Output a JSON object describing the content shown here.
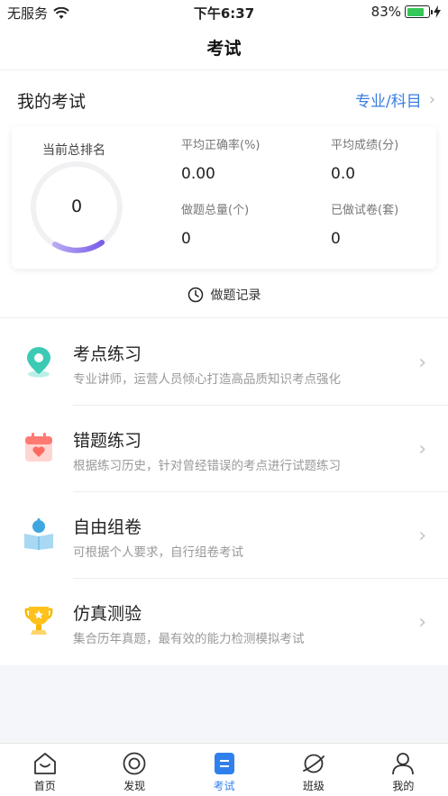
{
  "status_bar": {
    "carrier": "无服务",
    "time": "下午6:37",
    "battery": "83%",
    "battery_level": 0.83
  },
  "nav": {
    "title": "考试"
  },
  "my_exam": {
    "title": "我的考试",
    "subject_link": "专业/科目"
  },
  "stats": {
    "rank_label": "当前总排名",
    "rank_value": "0",
    "accuracy_label": "平均正确率(%)",
    "accuracy_value": "0.00",
    "score_label": "平均成绩(分)",
    "score_value": "0.0",
    "questions_label": "做题总量(个)",
    "questions_value": "0",
    "papers_label": "已做试卷(套)",
    "papers_value": "0"
  },
  "record": {
    "label": "做题记录"
  },
  "menu": [
    {
      "title": "考点练习",
      "desc": "专业讲师，运营人员倾心打造高品质知识考点强化",
      "icon": "location-pin-icon"
    },
    {
      "title": "错题练习",
      "desc": "根据练习历史，针对曾经错误的考点进行试题练习",
      "icon": "calendar-heart-icon"
    },
    {
      "title": "自由组卷",
      "desc": "可根据个人要求，自行组卷考试",
      "icon": "reader-book-icon"
    },
    {
      "title": "仿真测验",
      "desc": "集合历年真题，最有效的能力检测模拟考试",
      "icon": "trophy-icon"
    }
  ],
  "tabs": [
    {
      "label": "首页",
      "icon": "home-icon"
    },
    {
      "label": "发现",
      "icon": "discover-icon"
    },
    {
      "label": "考试",
      "icon": "exam-icon",
      "active": true
    },
    {
      "label": "班级",
      "icon": "planet-icon"
    },
    {
      "label": "我的",
      "icon": "user-icon"
    }
  ],
  "colors": {
    "accent": "#2f80ed",
    "link": "#3a7de0",
    "battery": "#34c759"
  }
}
